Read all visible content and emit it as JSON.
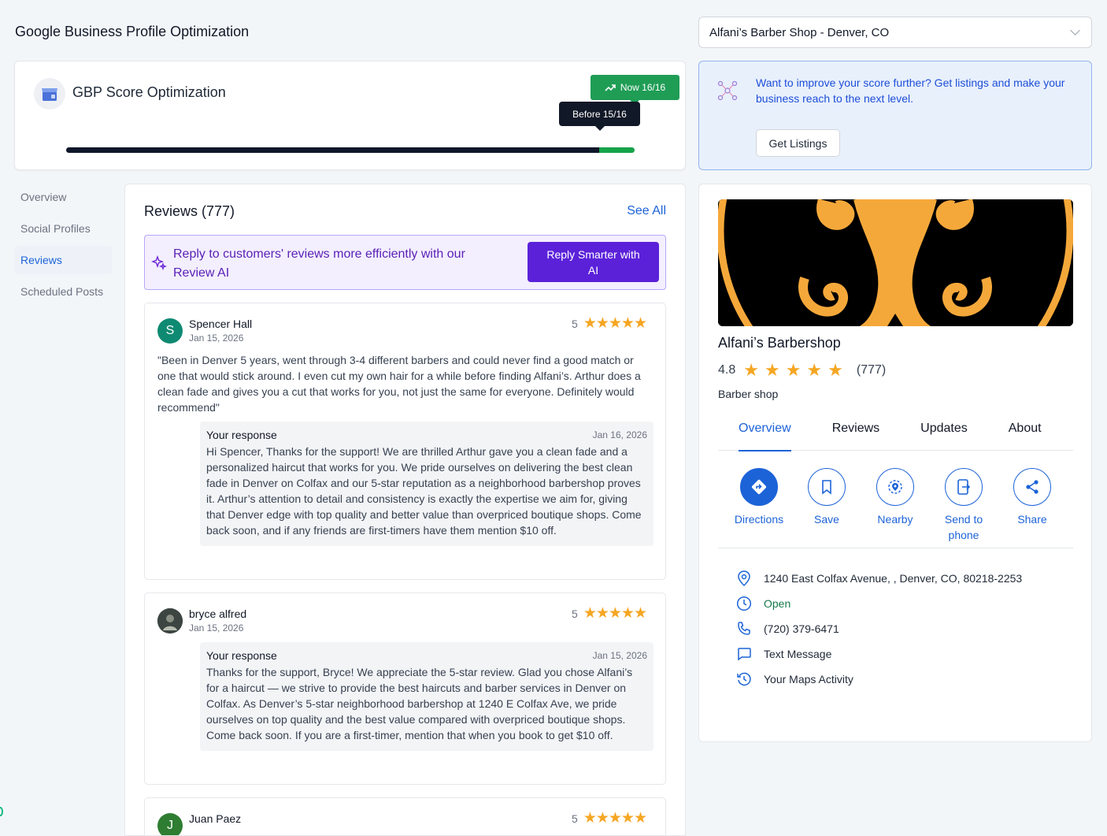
{
  "page": {
    "title": "Google Business Profile Optimization"
  },
  "business_selector": {
    "value": "Alfani’s Barber Shop - Denver, CO"
  },
  "score": {
    "title": "GBP Score Optimization",
    "now_label": "Now 16/16",
    "before_label": "Before 15/16",
    "before_fraction": 0.9375,
    "now_fraction": 1.0,
    "colors": {
      "before": "#0f172a",
      "gain": "#16a34a"
    }
  },
  "listings": {
    "message": "Want to improve your score further? Get listings and make your business reach to the next level.",
    "button_label": "Get Listings"
  },
  "nav": {
    "items": [
      {
        "label": "Overview",
        "active": false
      },
      {
        "label": "Social Profiles",
        "active": false
      },
      {
        "label": "Reviews",
        "active": true
      },
      {
        "label": "Scheduled Posts",
        "active": false
      }
    ]
  },
  "reviews": {
    "title": "Reviews (777)",
    "see_all": "See All",
    "ai_banner": {
      "text": "Reply to customers' reviews more efficiently with our Review AI",
      "button_label": "Reply Smarter with AI"
    },
    "items": [
      {
        "initial": "S",
        "name": "Spencer Hall",
        "date": "Jan 15, 2026",
        "rating": "5",
        "stars": "★★★★★",
        "text": "\"Been in Denver 5 years, went through 3-4 different barbers and could never find a good match or one that would stick around. I even cut my own hair for a while before finding Alfani’s. Arthur does a clean fade and gives you a cut that works for you, not just the same for everyone. Definitely would recommend\"",
        "response_label": "Your response",
        "response_date": "Jan 16, 2026",
        "response_text": "Hi Spencer, Thanks for the support! We are thrilled Arthur gave you a clean fade and a personalized haircut that works for you. We pride ourselves on delivering the best clean fade in Denver on Colfax and our 5-star reputation as a neighborhood barbershop proves it. Arthur’s attention to detail and consistency is exactly the expertise we aim for, giving that Denver edge with top quality and better value than overpriced boutique shops. Come back soon, and if any friends are first-timers have them mention $10 off."
      },
      {
        "initial": "",
        "name": "bryce alfred",
        "date": "Jan 15, 2026",
        "rating": "5",
        "stars": "★★★★★",
        "text": "",
        "response_label": "Your response",
        "response_date": "Jan 15, 2026",
        "response_text": "Thanks for the support, Bryce! We appreciate the 5-star review. Glad you chose Alfani’s for a haircut — we strive to provide the best haircuts and barber services in Denver on Colfax. As Denver’s 5-star neighborhood barbershop at 1240 E Colfax Ave, we pride ourselves on top quality and the best value compared with overpriced boutique shops. Come back soon. If you are a first-timer, mention that when you book to get $10 off."
      },
      {
        "initial": "J",
        "name": "Juan Paez",
        "rating": "5",
        "stars": "★★★★★"
      }
    ]
  },
  "business": {
    "name": "Alfani’s Barbershop",
    "rating": "4.8",
    "stars": "★★★★★",
    "review_count": "(777)",
    "category": "Barber shop",
    "tabs": [
      "Overview",
      "Reviews",
      "Updates",
      "About"
    ],
    "actions": [
      "Directions",
      "Save",
      "Nearby",
      "Send to phone",
      "Share"
    ],
    "info": {
      "address": "1240 East Colfax Avenue, , Denver, CO, 80218-2253",
      "hours": "Open",
      "phone": "(720) 379-6471",
      "text_message": "Text Message",
      "maps_activity": "Your Maps Activity"
    },
    "colors": {
      "accent": "#1d63d8",
      "logo_orange": "#f5a83a",
      "open_green": "#16794a"
    }
  }
}
